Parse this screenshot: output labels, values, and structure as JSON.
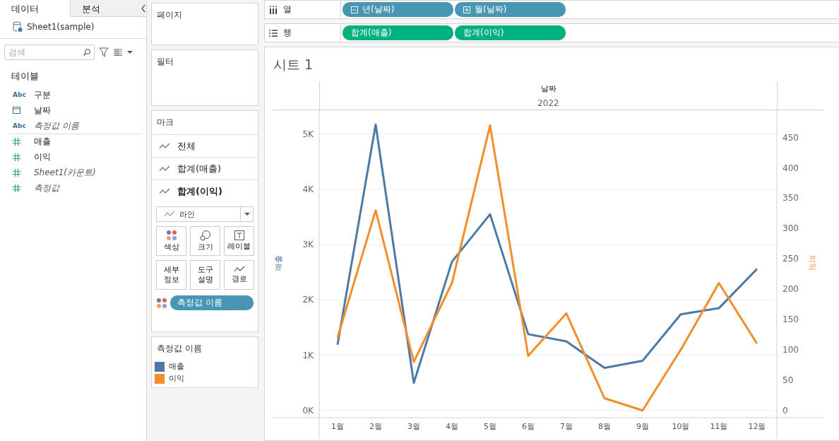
{
  "sidebar": {
    "tabs": [
      {
        "label": "데이터",
        "selected": true
      },
      {
        "label": "분석",
        "selected": false
      }
    ],
    "datasource": "Sheet1(sample)",
    "search": {
      "placeholder": "검색"
    },
    "section_title": "테이블",
    "fields": [
      {
        "kind": "dimension",
        "icon_text": "Abc",
        "label": "구분",
        "calculated": false
      },
      {
        "kind": "date",
        "label": "날짜",
        "calculated": false
      },
      {
        "kind": "dimension",
        "icon_text": "Abc",
        "label": "측정값 이름",
        "calculated": true
      },
      {
        "kind": "measure",
        "label": "매출",
        "calculated": false
      },
      {
        "kind": "measure",
        "label": "이익",
        "calculated": false
      },
      {
        "kind": "measure",
        "label": "Sheet1(카운트)",
        "calculated": true
      },
      {
        "kind": "measure",
        "label": "측정값",
        "calculated": true
      }
    ]
  },
  "pages_card": {
    "title": "페이지"
  },
  "filters_card": {
    "title": "필터"
  },
  "marks_card": {
    "title": "마크",
    "layers": [
      {
        "label": "전체",
        "selected": false
      },
      {
        "label": "합계(매출)",
        "selected": false
      },
      {
        "label": "합계(이익)",
        "selected": true
      }
    ],
    "mark_type": "라인",
    "buttons": [
      {
        "kind": "color",
        "label": "색상"
      },
      {
        "kind": "size",
        "label": "크기"
      },
      {
        "kind": "label",
        "label": "레이블"
      },
      {
        "kind": "detail",
        "label": "세부 정보"
      },
      {
        "kind": "tooltip",
        "label": "도구 설명"
      },
      {
        "kind": "path",
        "label": "경로"
      }
    ],
    "color_pill": "측정값 이름"
  },
  "legend": {
    "title": "측정값 이름"
  },
  "shelves": [
    {
      "kind": "columns",
      "label": "열",
      "pills": [
        {
          "kind": "dimension",
          "label": "년(날짜)",
          "expanded": true
        },
        {
          "kind": "dimension",
          "label": "월(날짜)",
          "expanded": false
        }
      ]
    },
    {
      "kind": "rows",
      "label": "행",
      "pills": [
        {
          "kind": "measure",
          "label": "합계(매출)"
        },
        {
          "kind": "measure",
          "label": "합계(이익)"
        }
      ]
    }
  ],
  "sheet": {
    "title": "시트 1",
    "header_field": "날짜",
    "header_value": "2022",
    "chart_data": {
      "type": "line",
      "ylabel": "매출",
      "y2label": "이익",
      "grid": true,
      "categories": [
        "1월",
        "2월",
        "3월",
        "4월",
        "5월",
        "6월",
        "7월",
        "8월",
        "9월",
        "10월",
        "11월",
        "12월"
      ],
      "series": [
        {
          "name": "매출",
          "color": "#4e79a7",
          "values": [
            1190,
            5170,
            500,
            2690,
            3550,
            1380,
            1250,
            770,
            900,
            1740,
            1850,
            2560
          ]
        },
        {
          "name": "이익",
          "color": "#f28e2b",
          "axis": "y2",
          "values": [
            120,
            330,
            80,
            210,
            470,
            90,
            160,
            20,
            0,
            100,
            210,
            110
          ]
        }
      ],
      "ylim": [
        -130,
        5430
      ],
      "yticks": [
        {
          "value": 0,
          "label": "0K"
        },
        {
          "value": 1000,
          "label": "1K"
        },
        {
          "value": 2000,
          "label": "2K"
        },
        {
          "value": 3000,
          "label": "3K"
        },
        {
          "value": 4000,
          "label": "4K"
        },
        {
          "value": 5000,
          "label": "5K"
        }
      ],
      "y2lim": [
        -12,
        495
      ],
      "y2ticks": [
        0,
        50,
        100,
        150,
        200,
        250,
        300,
        350,
        400,
        450
      ]
    }
  }
}
